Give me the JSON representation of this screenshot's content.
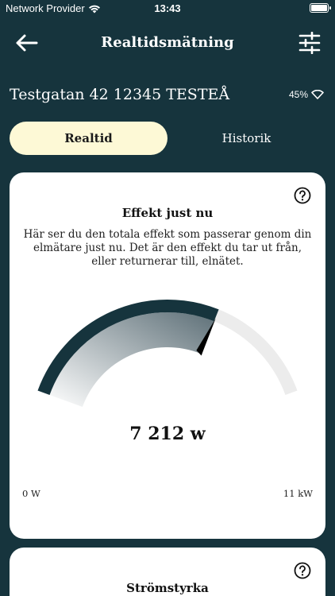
{
  "status_bar": {
    "carrier": "Network Provider",
    "time": "13:43"
  },
  "nav": {
    "title": "Realtidsmätning"
  },
  "location": {
    "address": "Testgatan 42 12345 TESTEÅ",
    "signal": "45%"
  },
  "tabs": [
    {
      "label": "Realtid",
      "active": true
    },
    {
      "label": "Historik",
      "active": false
    }
  ],
  "power_card": {
    "title": "Effekt just nu",
    "description": "Här ser du den totala effekt som passerar genom din elmätare just nu. Det är den effekt du tar ut från, eller returnerar till, elnätet.",
    "value_label": "7 212 w",
    "current_w": 7212,
    "max_w": 11000,
    "min_label": "0 W",
    "max_label": "11 kW"
  },
  "current_card": {
    "title": "Strömstyrka"
  },
  "colors": {
    "background": "#16343d",
    "tab_active": "#fdf9d6",
    "gauge_track": "#ececec"
  }
}
